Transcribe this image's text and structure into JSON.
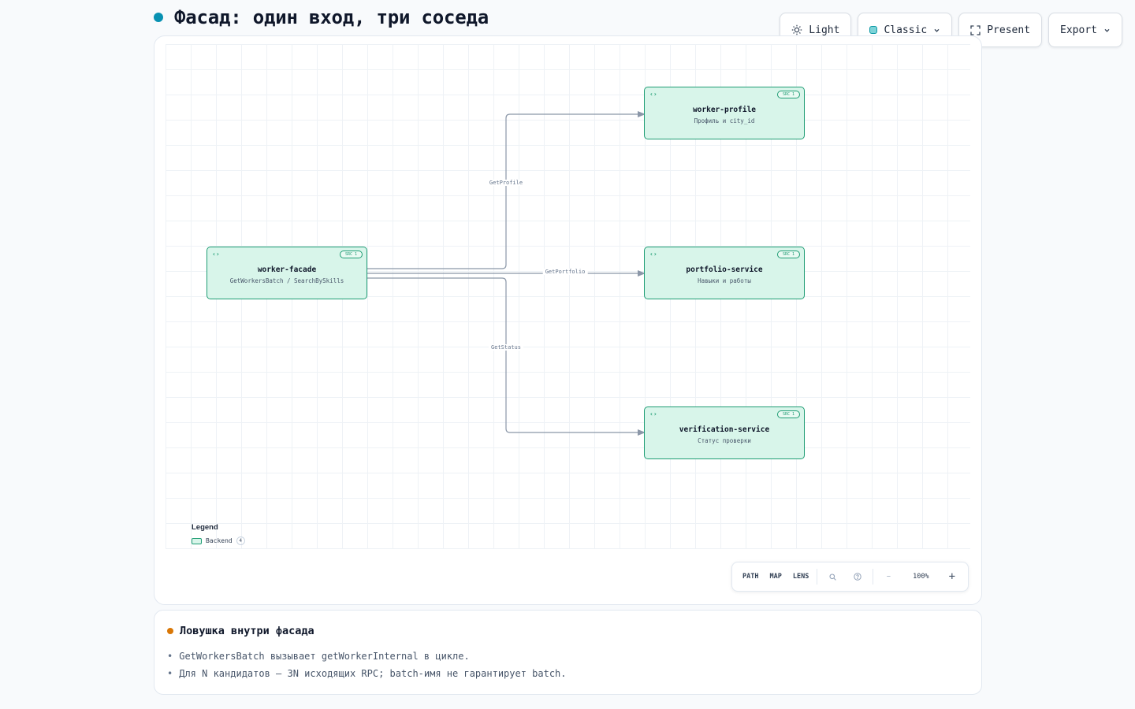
{
  "header": {
    "title": "Фасад: один вход, три соседа",
    "accent_color": "#0891b2"
  },
  "toolbar": {
    "theme_label": "Light",
    "style_label": "Classic",
    "present_label": "Present",
    "export_label": "Export"
  },
  "diagram": {
    "nodes": [
      {
        "id": "worker-facade",
        "title": "worker-facade",
        "subtitle": "GetWorkersBatch / SearchBySkills",
        "badge": "SRC 1"
      },
      {
        "id": "worker-profile",
        "title": "worker-profile",
        "subtitle": "Профиль и city_id",
        "badge": "SRC 1"
      },
      {
        "id": "portfolio-service",
        "title": "portfolio-service",
        "subtitle": "Навыки и работы",
        "badge": "SRC 1"
      },
      {
        "id": "verification-service",
        "title": "verification-service",
        "subtitle": "Статус проверки",
        "badge": "SRC 1"
      }
    ],
    "edges": [
      {
        "from": "worker-facade",
        "to": "worker-profile",
        "label": "GetProfile"
      },
      {
        "from": "worker-facade",
        "to": "portfolio-service",
        "label": "GetPortfolio"
      },
      {
        "from": "worker-facade",
        "to": "verification-service",
        "label": "GetStatus"
      }
    ],
    "node_fill": "#d8f5ea",
    "node_stroke": "#1f9d74",
    "edge_color": "#8b97a8"
  },
  "legend": {
    "title": "Legend",
    "items": [
      {
        "label": "Backend",
        "count": "4"
      }
    ]
  },
  "controls": {
    "path_label": "PATH",
    "map_label": "MAP",
    "lens_label": "LENS",
    "search_icon": "search-icon",
    "help_icon": "help-icon",
    "zoom_out": "−",
    "zoom_level": "100%",
    "zoom_in": "+"
  },
  "note": {
    "title": "Ловушка внутри фасада",
    "accent_color": "#d97706",
    "items": [
      "GetWorkersBatch вызывает getWorkerInternal в цикле.",
      "Для N кандидатов — 3N исходящих RPC; batch-имя не гарантирует batch."
    ]
  }
}
